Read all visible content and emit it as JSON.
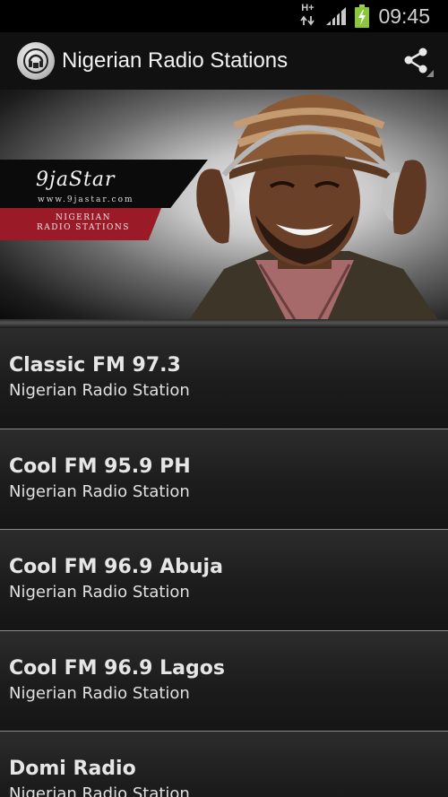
{
  "status_bar": {
    "network_type": "H+",
    "time": "09:45",
    "icons": [
      "data-arrows-icon",
      "signal-icon",
      "battery-charging-icon"
    ]
  },
  "action_bar": {
    "title": "Nigerian Radio Stations",
    "logo_icon": "radio-tower-icon",
    "share_icon": "share-icon"
  },
  "banner": {
    "logo_text": "9jaStar",
    "url": "www.9jastar.com",
    "subtitle_line1": "NIGERIAN",
    "subtitle_line2": "RADIO STATIONS"
  },
  "stations": [
    {
      "name": "Classic FM 97.3",
      "subtitle": "Nigerian Radio Station"
    },
    {
      "name": "Cool FM 95.9 PH",
      "subtitle": "Nigerian Radio Station"
    },
    {
      "name": "Cool FM 96.9 Abuja",
      "subtitle": "Nigerian Radio Station"
    },
    {
      "name": "Cool FM 96.9 Lagos",
      "subtitle": "Nigerian Radio Station"
    },
    {
      "name": "Domi Radio",
      "subtitle": "Nigerian Radio Station"
    }
  ],
  "colors": {
    "background": "#000000",
    "list_text": "#e6e6e6",
    "banner_accent": "#9b1a28"
  }
}
